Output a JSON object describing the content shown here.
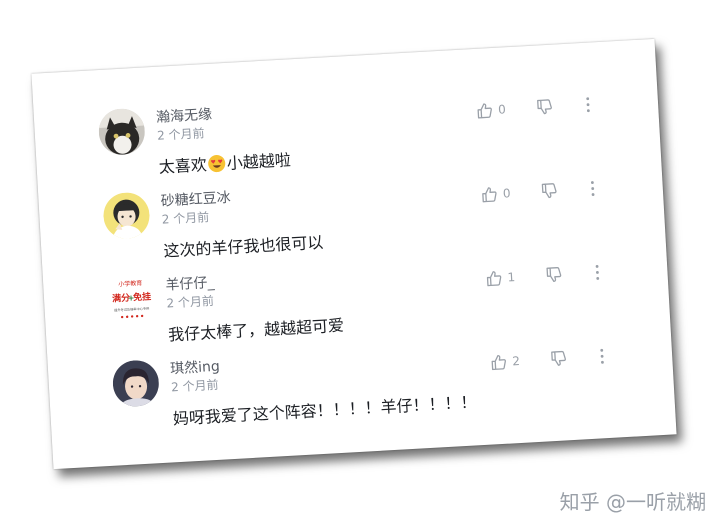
{
  "comments": [
    {
      "username": "瀚海无缘",
      "time": "2 个月前",
      "text_before": "太喜欢",
      "emoji": "heart-eyes",
      "text_after": "小越越啦",
      "likes": "0"
    },
    {
      "username": "砂糖红豆冰",
      "time": "2 个月前",
      "text": "这次的羊仔我也很可以",
      "likes": "0"
    },
    {
      "username": "羊仔仔_",
      "time": "2 个月前",
      "text": "我仔太棒了，越越超可爱",
      "likes": "1",
      "avatar_text": {
        "line1": "小学教育",
        "line2": "满分",
        "line3": "免挂",
        "line4": "提升考试及格率中心专供"
      }
    },
    {
      "username": "琪然ing",
      "time": "2 个月前",
      "text": "妈呀我爱了这个阵容！！！！羊仔！！！！",
      "likes": "2"
    }
  ],
  "watermark": "知乎 @一听就糊",
  "colors": {
    "username": "#555a63",
    "time": "#9097a2",
    "text": "#1c1f24",
    "icon": "#9aa0a8"
  }
}
